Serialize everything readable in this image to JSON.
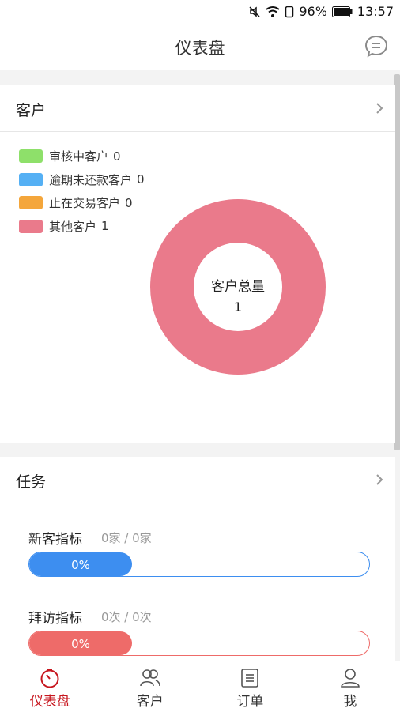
{
  "status_bar": {
    "battery": "96%",
    "time": "13:57"
  },
  "header": {
    "title": "仪表盘"
  },
  "customers_card": {
    "title": "客户",
    "legend": [
      {
        "label": "审核中客户",
        "count": "0",
        "color": "#8ee06a"
      },
      {
        "label": "逾期未还款客户",
        "count": "0",
        "color": "#55b0f4"
      },
      {
        "label": "止在交易客户",
        "count": "0",
        "color": "#f4a63b"
      },
      {
        "label": "其他客户",
        "count": "1",
        "color": "#ea7a8b"
      }
    ],
    "donut": {
      "center_label": "客户总量",
      "center_value": "1"
    }
  },
  "chart_data": {
    "type": "pie",
    "categories": [
      "审核中客户",
      "逾期未还款客户",
      "止在交易客户",
      "其他客户"
    ],
    "values": [
      0,
      0,
      0,
      1
    ],
    "colors": [
      "#8ee06a",
      "#55b0f4",
      "#f4a63b",
      "#ea7a8b"
    ],
    "center_text": "客户总量",
    "total": 1,
    "legend_position": "top-left"
  },
  "tasks_card": {
    "title": "任务",
    "items": [
      {
        "name": "新客指标",
        "count": "0家 / 0家",
        "percent_label": "0%",
        "progress": 0,
        "color": "#3d8ef0"
      },
      {
        "name": "拜访指标",
        "count": "0次 / 0次",
        "percent_label": "0%",
        "progress": 0,
        "color": "#ee6b69"
      }
    ]
  },
  "tabs": [
    {
      "label": "仪表盘",
      "icon": "dashboard-icon",
      "active": true
    },
    {
      "label": "客户",
      "icon": "customers-icon",
      "active": false
    },
    {
      "label": "订单",
      "icon": "orders-icon",
      "active": false
    },
    {
      "label": "我",
      "icon": "profile-icon",
      "active": false
    }
  ]
}
